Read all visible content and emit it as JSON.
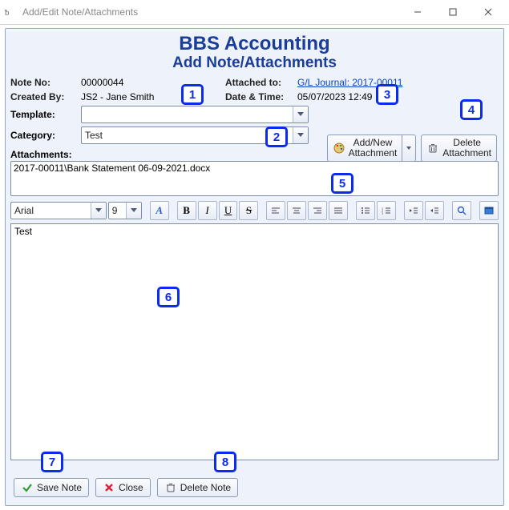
{
  "window": {
    "title": "Add/Edit Note/Attachments"
  },
  "header": {
    "line1": "BBS Accounting",
    "line2": "Add Note/Attachments"
  },
  "meta": {
    "note_no_label": "Note No:",
    "note_no_value": "00000044",
    "attached_to_label": "Attached to:",
    "attached_to_value": "G/L Journal: 2017-00011",
    "created_by_label": "Created By:",
    "created_by_value": "JS2 - Jane Smith",
    "datetime_label": "Date & Time:",
    "datetime_value": "05/07/2023 12:49"
  },
  "form": {
    "template_label": "Template:",
    "template_value": "",
    "category_label": "Category:",
    "category_value": "Test"
  },
  "buttons": {
    "add_attachment_l1": "Add/New",
    "add_attachment_l2": "Attachment",
    "delete_attachment_l1": "Delete",
    "delete_attachment_l2": "Attachment",
    "save_note": "Save Note",
    "close": "Close",
    "delete_note": "Delete Note"
  },
  "attachments": {
    "label": "Attachments:",
    "items": [
      "2017-00011\\Bank Statement 06-09-2021.docx"
    ]
  },
  "toolbar": {
    "font": "Arial",
    "size": "9"
  },
  "editor": {
    "content": "Test"
  },
  "badges": {
    "1": "1",
    "2": "2",
    "3": "3",
    "4": "4",
    "5": "5",
    "6": "6",
    "7": "7",
    "8": "8"
  }
}
